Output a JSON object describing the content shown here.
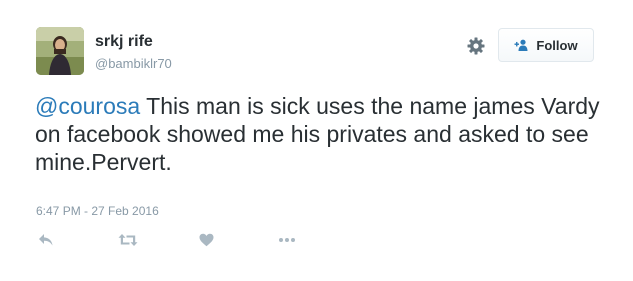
{
  "user": {
    "name": "srkj rife",
    "handle": "@bambiklr70",
    "avatar_icon": "profile-photo"
  },
  "header": {
    "settings_icon": "gear-icon",
    "follow_label": "Follow",
    "follow_icon": "add-user-icon"
  },
  "tweet": {
    "mention": "@courosa",
    "text": " This man is sick uses the name james Vardy on facebook showed me his privates and asked to see mine.Pervert.",
    "timestamp": "6:47 PM - 27 Feb 2016"
  },
  "actions": [
    {
      "icon": "reply-icon"
    },
    {
      "icon": "retweet-icon"
    },
    {
      "icon": "like-heart-icon"
    },
    {
      "icon": "more-options-icon"
    }
  ],
  "colors": {
    "link": "#2b7bb9",
    "text": "#292f33",
    "muted": "#8899a6",
    "icon": "#aab8c2"
  }
}
